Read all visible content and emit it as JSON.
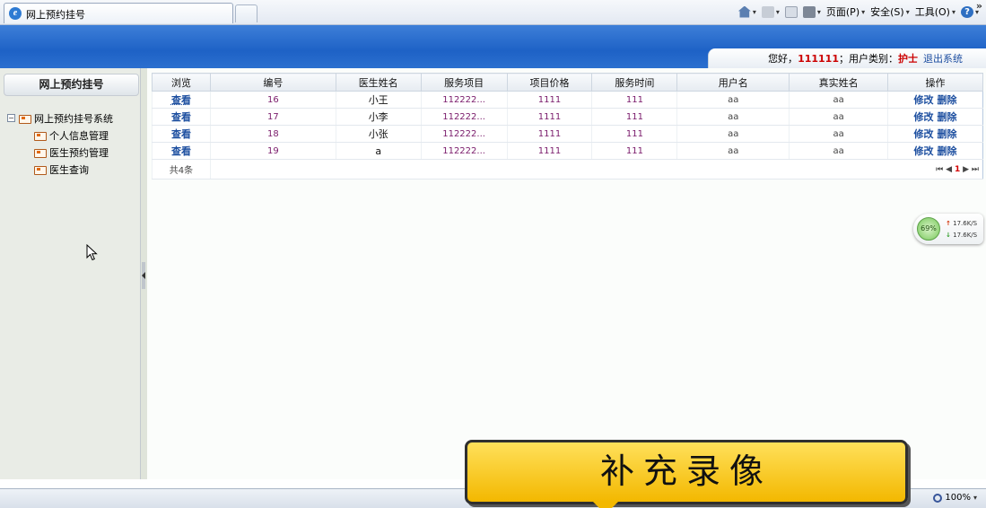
{
  "browser": {
    "tab_title": "网上预约挂号",
    "commands": [
      "页面(P)",
      "安全(S)",
      "工具(O)"
    ]
  },
  "header": {
    "greeting": "您好，",
    "username": "111111",
    "role_label": "；用户类别：",
    "role": "护士",
    "logout": "退出系统"
  },
  "sidebar": {
    "title": "网上预约挂号",
    "root": "网上预约挂号系统",
    "items": [
      {
        "label": "个人信息管理"
      },
      {
        "label": "医生预约管理"
      },
      {
        "label": "医生查询"
      }
    ]
  },
  "table": {
    "headers": [
      "浏览",
      "编号",
      "医生姓名",
      "服务项目",
      "项目价格",
      "服务时间",
      "用户名",
      "真实姓名",
      "操作"
    ],
    "rows": [
      {
        "view": "查看",
        "id": "16",
        "doctor": "小王",
        "service": "112222...",
        "price": "1111",
        "time": "111",
        "user": "aa",
        "real": "aa",
        "edit": "修改",
        "delete": "删除"
      },
      {
        "view": "查看",
        "id": "17",
        "doctor": "小李",
        "service": "112222...",
        "price": "1111",
        "time": "111",
        "user": "aa",
        "real": "aa",
        "edit": "修改",
        "delete": "删除"
      },
      {
        "view": "查看",
        "id": "18",
        "doctor": "小张",
        "service": "112222...",
        "price": "1111",
        "time": "111",
        "user": "aa",
        "real": "aa",
        "edit": "修改",
        "delete": "删除"
      },
      {
        "view": "查看",
        "id": "19",
        "doctor": "a",
        "service": "112222...",
        "price": "1111",
        "time": "111",
        "user": "aa",
        "real": "aa",
        "edit": "修改",
        "delete": "删除"
      }
    ],
    "total": "共4条",
    "page": "1"
  },
  "network_widget": {
    "percent": "69%",
    "up": "17.6K/S",
    "down": "17.6K/S"
  },
  "statusbar": {
    "zoom": "100%"
  },
  "overlay": {
    "text": "补充录像"
  }
}
